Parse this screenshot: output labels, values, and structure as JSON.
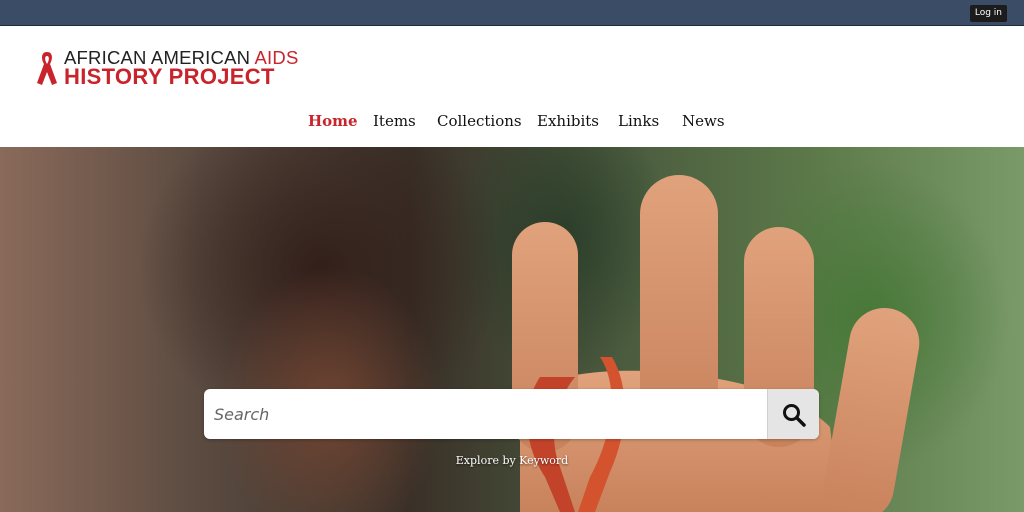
{
  "topbar": {
    "login_label": "Log in"
  },
  "logo": {
    "line1_main": "AFRICAN AMERICAN ",
    "line1_accent": "AIDS",
    "line2": "HISTORY PROJECT"
  },
  "nav": {
    "items": [
      {
        "label": "Home",
        "active": true
      },
      {
        "label": "Items"
      },
      {
        "label": "Collections"
      },
      {
        "label": "Exhibits"
      },
      {
        "label": "Links"
      },
      {
        "label": "News"
      }
    ]
  },
  "search": {
    "placeholder": "Search",
    "value": "",
    "icon": "magnifier-icon"
  },
  "hero": {
    "explore_label": "Explore by Keyword"
  },
  "colors": {
    "accent": "#c9242b",
    "topbar": "#3b4c66"
  }
}
